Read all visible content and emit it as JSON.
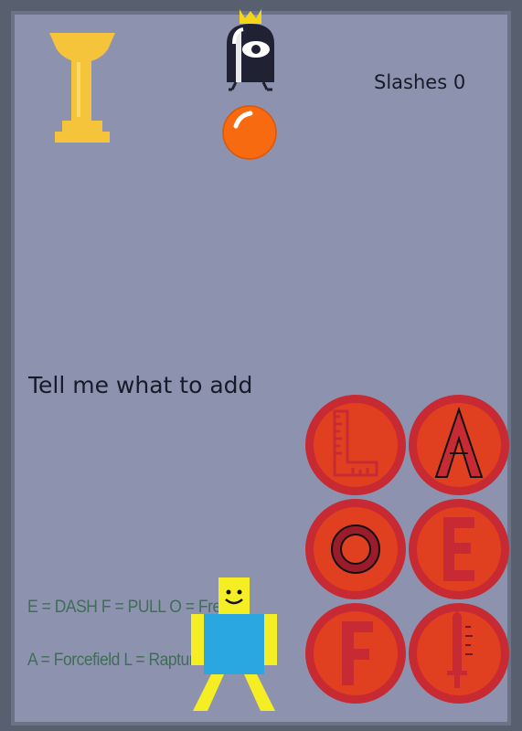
{
  "hud": {
    "slashes_label": "Slashes 0"
  },
  "prompt_text": "Tell me what to add",
  "controls": {
    "line1": "E = DASH F = PULL O = Freeze",
    "line2": "A = Forcefield L = Rapture"
  },
  "ability_buttons": [
    {
      "key": "L",
      "icon": "ruler-L-icon"
    },
    {
      "key": "A",
      "icon": "triangle-A-icon"
    },
    {
      "key": "O",
      "icon": "ring-O-icon"
    },
    {
      "key": "E",
      "icon": "letter-E-icon"
    },
    {
      "key": "F",
      "icon": "letter-F-icon"
    },
    {
      "key": "!",
      "icon": "sword-icon"
    }
  ],
  "colors": {
    "background": "#8d93ae",
    "button_fill": "#e0401f",
    "button_ring": "#c82a33",
    "trophy": "#f6c43a",
    "ball": "#f86a10",
    "player_head": "#f5ee24",
    "player_body": "#2aa6e0"
  }
}
